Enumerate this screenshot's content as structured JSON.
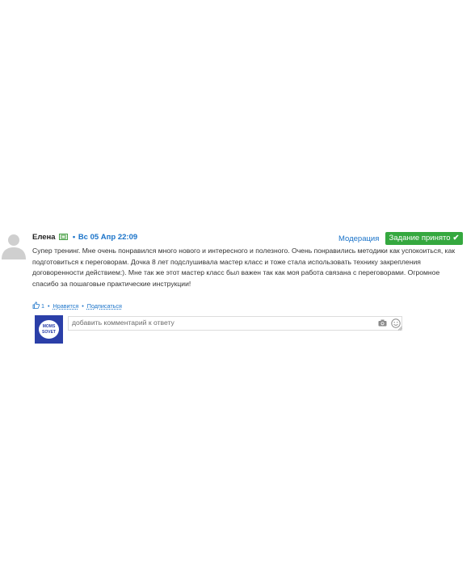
{
  "comment": {
    "author": "Елена",
    "date": "Вс 05 Апр 22:09",
    "moderation_label": "Модерация",
    "status_badge": "Задание принято",
    "text": "Супер тренинг. Мне очень понравился много нового и интересного и полезного. Очень понравились методики как успокоиться, как подготовиться к переговорам. Дочка 8 лет подслушивала мастер класс и тоже стала использовать технику закрепления договоренности действием:). Мне так же этот мастер класс был важен так как моя работа связана с переговорами. Огромное спасибо за пошаговые практические инструкции!",
    "likes_count": "1",
    "like_label": "Нравится",
    "subscribe_label": "Подписаться"
  },
  "reply": {
    "placeholder": "добавить комментарий к ответу",
    "logo_text_1": "MOMS",
    "logo_text_2": "SOVET"
  },
  "colors": {
    "link": "#1a73c9",
    "badge": "#35a83f",
    "logo_bg": "#2b3fa8"
  }
}
